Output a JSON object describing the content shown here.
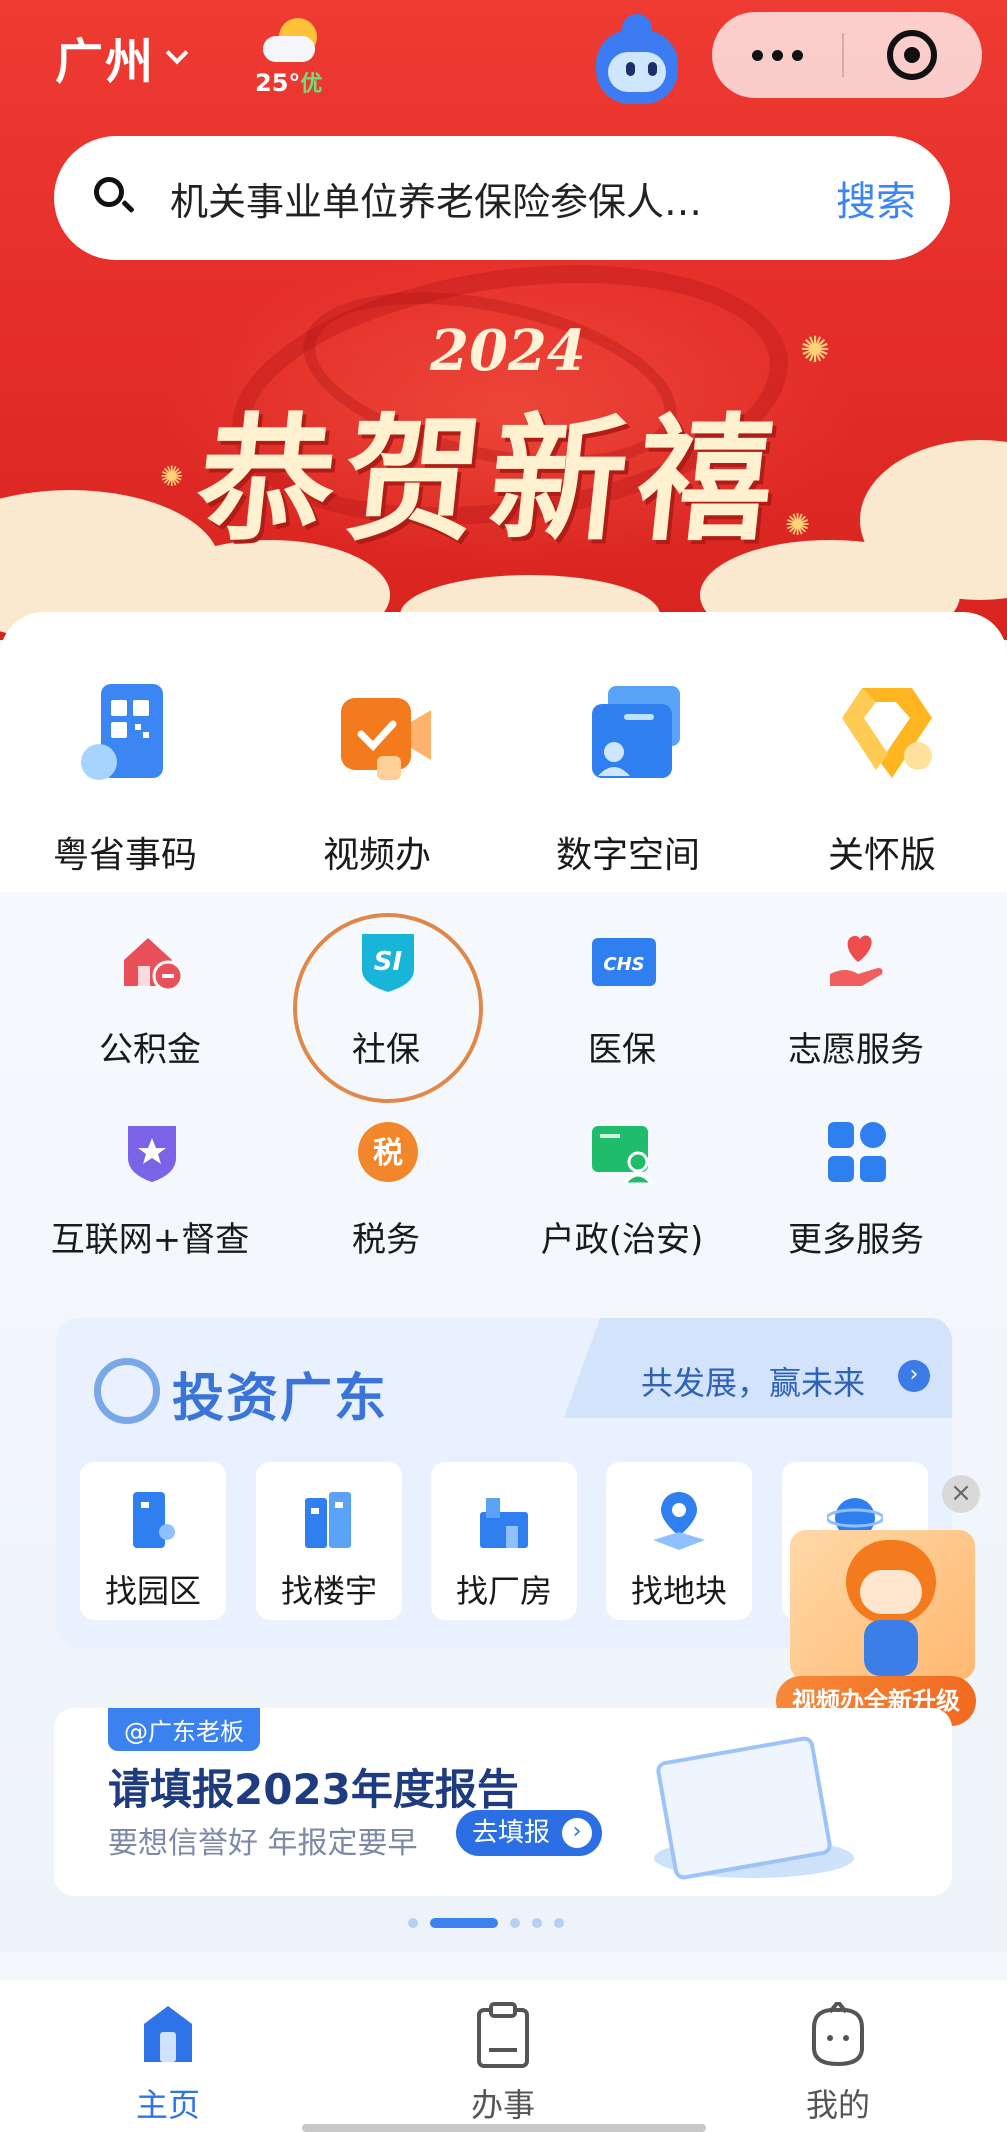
{
  "header": {
    "city": "广州",
    "weather": {
      "temp": "25°",
      "quality": "优"
    }
  },
  "search": {
    "query": "机关事业单位养老保险参保人…",
    "button": "搜索"
  },
  "banner": {
    "year": "2024",
    "title": "恭贺新禧"
  },
  "quick_services": [
    {
      "label": "粤省事码"
    },
    {
      "label": "视频办"
    },
    {
      "label": "数字空间"
    },
    {
      "label": "关怀版"
    }
  ],
  "services": [
    {
      "label": "公积金"
    },
    {
      "label": "社保",
      "icon_text": "SI"
    },
    {
      "label": "医保",
      "icon_text": "CHS"
    },
    {
      "label": "志愿服务"
    },
    {
      "label": "互联网+督查"
    },
    {
      "label": "税务",
      "icon_text": "税"
    },
    {
      "label": "户政(治安)"
    },
    {
      "label": "更多服务"
    }
  ],
  "invest": {
    "title": "投资广东",
    "slogan": "共发展，赢未来",
    "tiles": [
      {
        "label": "找园区"
      },
      {
        "label": "找楼宇"
      },
      {
        "label": "找厂房"
      },
      {
        "label": "找地块"
      }
    ]
  },
  "floating": {
    "tag": "视频办全新升级"
  },
  "promo": {
    "tag": "@广东老板",
    "title": "请填报2023年度报告",
    "subtitle": "要想信誉好 年报定要早",
    "button": "去填报"
  },
  "tabbar": [
    {
      "label": "主页",
      "active": true
    },
    {
      "label": "办事"
    },
    {
      "label": "我的"
    }
  ],
  "colors": {
    "brand_red": "#e62f2a",
    "accent_blue": "#2f73e8",
    "highlight_ring": "#e0884a"
  }
}
